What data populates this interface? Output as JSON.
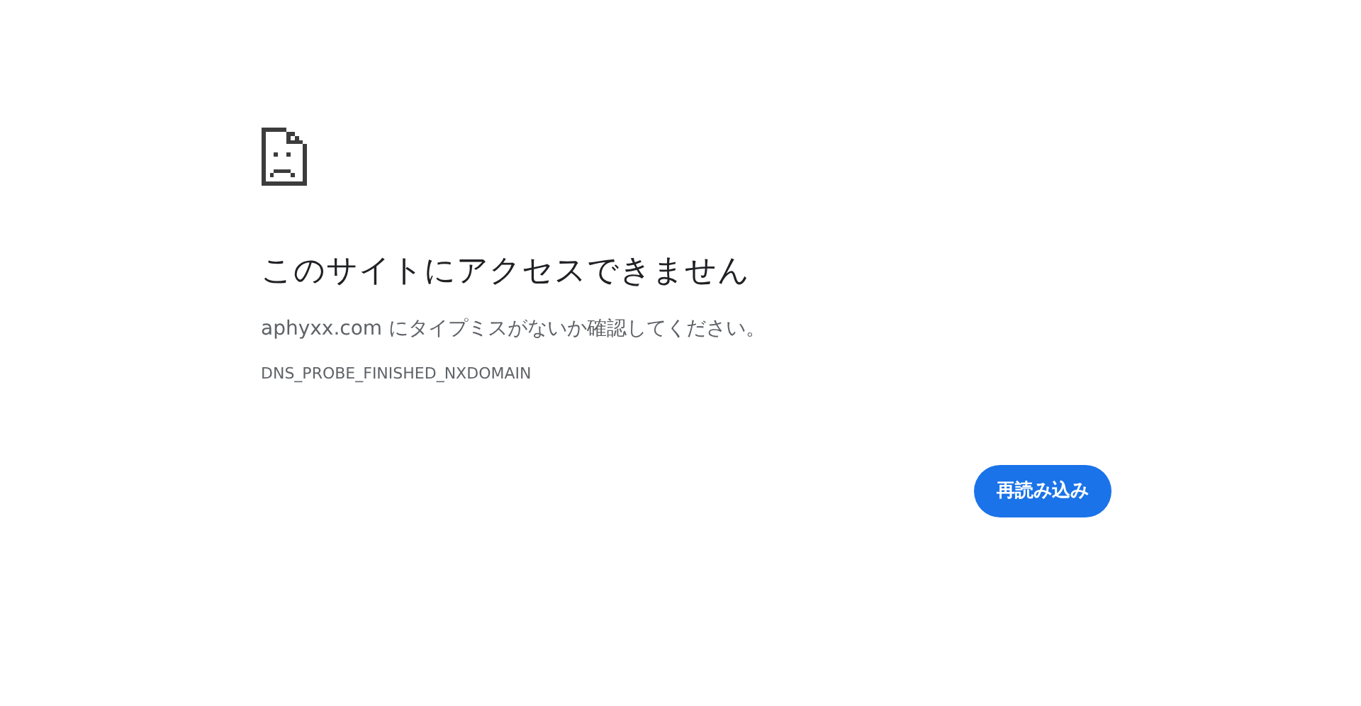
{
  "error": {
    "title": "このサイトにアクセスできません",
    "message": "aphyxx.com にタイプミスがないか確認してください。",
    "code": "DNS_PROBE_FINISHED_NXDOMAIN"
  },
  "buttons": [
    {
      "label": "再読み込み",
      "kind": "primary"
    }
  ]
}
